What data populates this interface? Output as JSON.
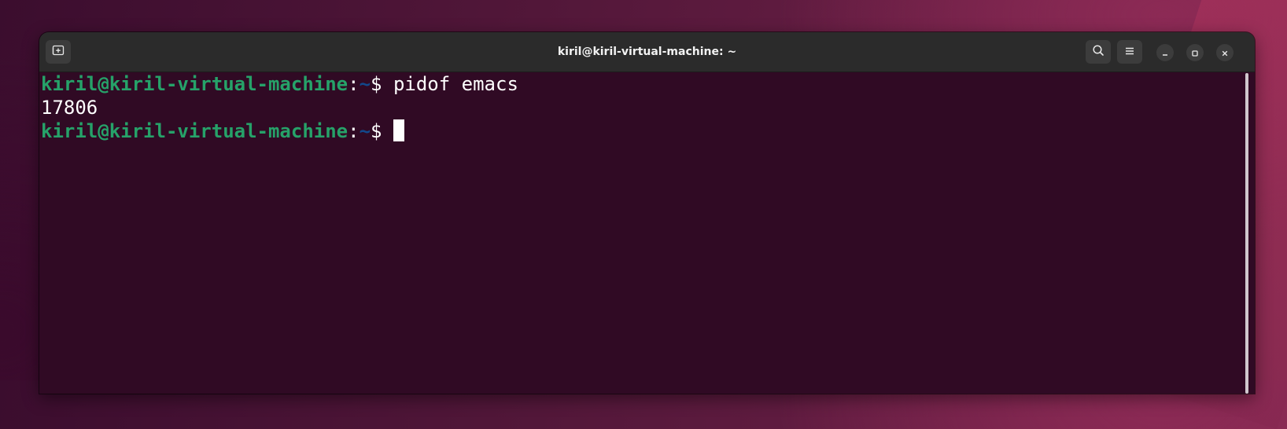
{
  "window": {
    "title": "kiril@kiril-virtual-machine: ~"
  },
  "headerbar": {
    "new_tab_icon": "new-tab-icon",
    "search_icon": "search-icon",
    "menu_icon": "hamburger-menu-icon",
    "minimize_icon": "minimize-icon",
    "maximize_icon": "maximize-icon",
    "close_icon": "close-icon"
  },
  "terminal": {
    "lines": [
      {
        "user_host": "kiril@kiril-virtual-machine",
        "colon": ":",
        "path": "~",
        "prompt": "$ ",
        "command": "pidof emacs"
      },
      {
        "output": "17806"
      },
      {
        "user_host": "kiril@kiril-virtual-machine",
        "colon": ":",
        "path": "~",
        "prompt": "$ ",
        "command": ""
      }
    ]
  },
  "colors": {
    "terminal_bg": "#300a24",
    "user_host": "#26a269",
    "path": "#12488b",
    "text": "#ffffff",
    "headerbar": "#2b2b2b"
  }
}
